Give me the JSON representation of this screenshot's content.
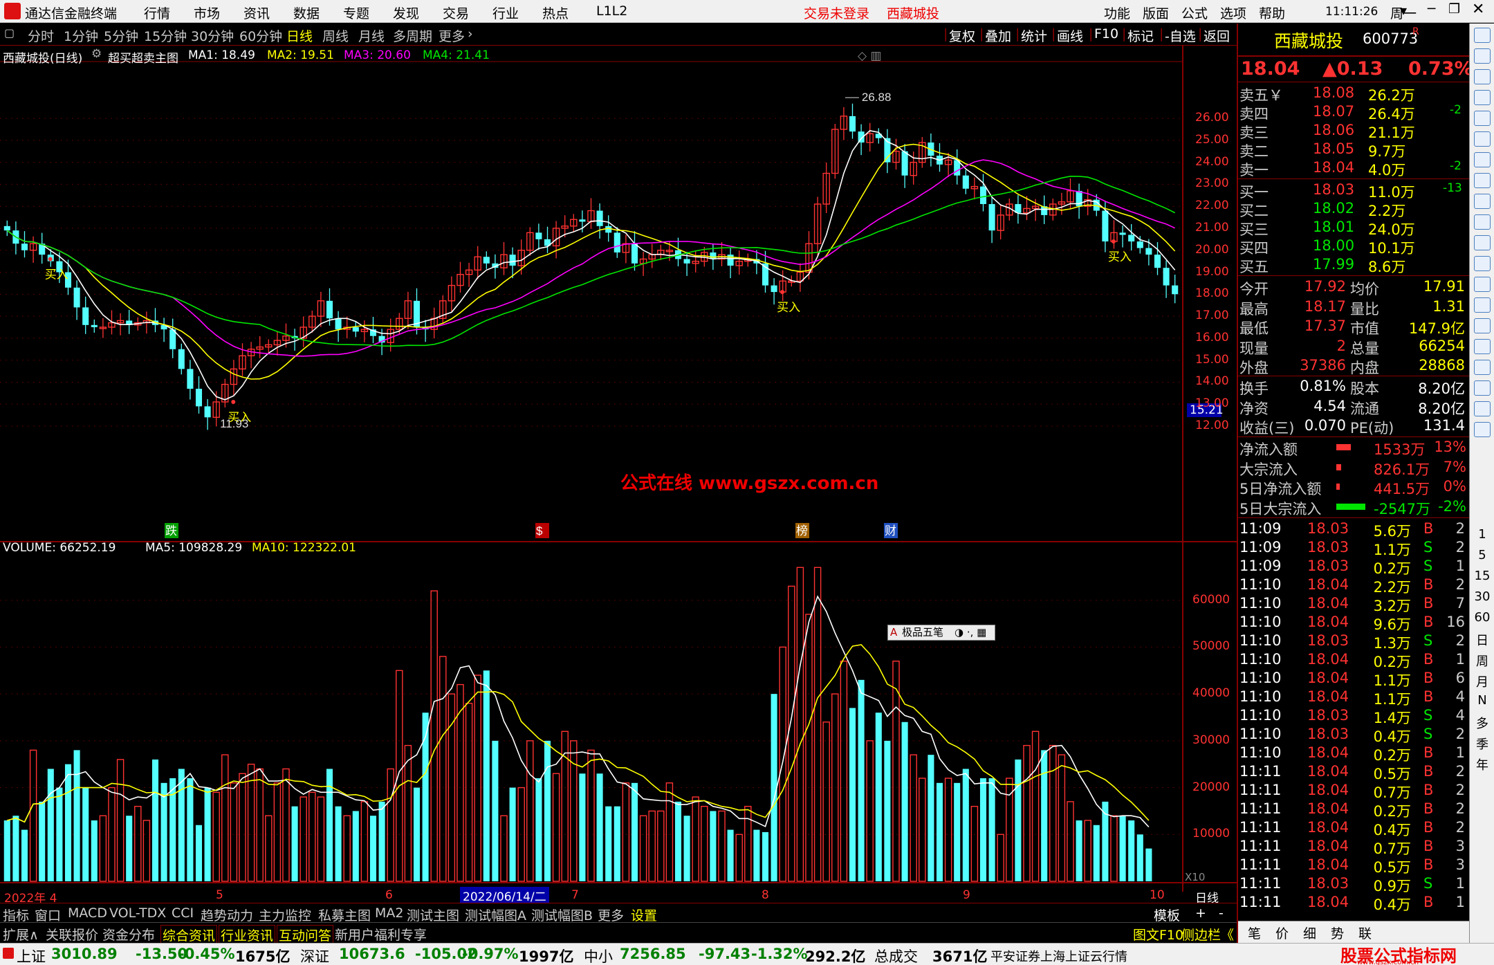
{
  "window": {
    "app_title": "通达信金融终端",
    "menu": [
      "行情",
      "市场",
      "资讯",
      "数据",
      "专题",
      "发现",
      "交易",
      "行业",
      "热点",
      "L1L2"
    ],
    "trade_status": "交易未登录",
    "stock_tab": "西藏城投",
    "right_menu": [
      "功能",
      "版面",
      "公式",
      "选项",
      "帮助"
    ],
    "clock": "11:11:26",
    "weekday": "周一"
  },
  "toolbar": {
    "periods": [
      "分时",
      "1分钟",
      "5分钟",
      "15分钟",
      "30分钟",
      "60分钟",
      "日线",
      "周线",
      "月线",
      "多周期",
      "更多"
    ],
    "active": "日线",
    "right_buttons": [
      "复权",
      "叠加",
      "统计",
      "画线",
      "F10",
      "标记",
      "-自选",
      "返回"
    ]
  },
  "main_chart": {
    "title": "西藏城投(日线)",
    "indicator": "超买超卖主图",
    "ma1": "MA1: 18.49",
    "ma2": "MA2: 19.51",
    "ma3": "MA3: 20.60",
    "ma4": "MA4: 21.41",
    "high_label": "26.88",
    "low_label": "11.93",
    "buy_label": "买入",
    "price_ticks": [
      "26.00",
      "25.00",
      "24.00",
      "23.00",
      "22.00",
      "21.00",
      "20.00",
      "19.00",
      "18.00",
      "17.00",
      "16.00",
      "15.00",
      "14.00",
      "13.00",
      "12.00"
    ],
    "crosshair_price": "15.21",
    "watermark": "公式在线   www.gszx.com.cn",
    "event_markers": [
      "跌",
      "$",
      "榜",
      "财"
    ]
  },
  "volume_chart": {
    "title": "VOLUME: 66252.19",
    "ma5": "MA5: 109828.29",
    "ma10": "MA10: 122322.01",
    "ticks": [
      "60000",
      "50000",
      "40000",
      "30000",
      "20000",
      "10000"
    ],
    "unit": "X10",
    "popup": "极品五笔"
  },
  "time_axis": {
    "labels": [
      "2022年 4",
      "5",
      "6",
      "7",
      "8",
      "9",
      "10"
    ],
    "cursor_date": "2022/06/14/二",
    "right_label": "日线"
  },
  "tabs_row1": {
    "items": [
      "指标",
      "窗口",
      "MACD",
      "VOL-TDX",
      "CCI",
      "趋势动力",
      "主力监控",
      "私募主图",
      "MA2",
      "测试主图",
      "测试幅图A",
      "测试幅图B",
      "更多",
      "设置"
    ],
    "right": [
      "模板",
      "+",
      "-"
    ]
  },
  "tabs_row2": {
    "items": [
      "扩展∧",
      "关联报价",
      "资金分布",
      "综合资讯",
      "行业资讯",
      "互动问答",
      "新用户福利专享"
    ],
    "right": [
      "图文F10",
      "侧边栏《"
    ]
  },
  "quote": {
    "name": "西藏城投",
    "code": "600773",
    "flag": "R",
    "price": "18.04",
    "change": "▲0.13",
    "pct": "0.73%",
    "asks": [
      {
        "label": "卖五￥",
        "price": "18.08",
        "vol": "26.2万",
        "delta": ""
      },
      {
        "label": "卖四",
        "price": "18.07",
        "vol": "26.4万",
        "delta": "-2"
      },
      {
        "label": "卖三",
        "price": "18.06",
        "vol": "21.1万",
        "delta": ""
      },
      {
        "label": "卖二",
        "price": "18.05",
        "vol": "9.7万",
        "delta": ""
      },
      {
        "label": "卖一",
        "price": "18.04",
        "vol": "4.0万",
        "delta": "-2"
      }
    ],
    "bids": [
      {
        "label": "买一",
        "price": "18.03",
        "vol": "11.0万",
        "delta": "-13"
      },
      {
        "label": "买二",
        "price": "18.02",
        "vol": "2.2万",
        "delta": ""
      },
      {
        "label": "买三",
        "price": "18.01",
        "vol": "24.0万",
        "delta": ""
      },
      {
        "label": "买四",
        "price": "18.00",
        "vol": "10.1万",
        "delta": ""
      },
      {
        "label": "买五",
        "price": "17.99",
        "vol": "8.6万",
        "delta": ""
      }
    ],
    "stats1": [
      [
        "今开",
        "17.92",
        "均价",
        "17.91"
      ],
      [
        "最高",
        "18.17",
        "量比",
        "1.31"
      ],
      [
        "最低",
        "17.37",
        "市值",
        "147.9亿"
      ],
      [
        "现量",
        "2",
        "总量",
        "66254"
      ],
      [
        "外盘",
        "37386",
        "内盘",
        "28868"
      ]
    ],
    "stats2": [
      [
        "换手",
        "0.81%",
        "股本",
        "8.20亿"
      ],
      [
        "净资",
        "4.54",
        "流通",
        "8.20亿"
      ],
      [
        "收益(三)",
        "0.070",
        "PE(动)",
        "131.4"
      ]
    ],
    "flows": [
      {
        "label": "净流入额",
        "val": "1533万",
        "pct": "13%",
        "bar": 0.35,
        "color": "#ff3232"
      },
      {
        "label": "大宗流入",
        "val": "826.1万",
        "pct": "7%",
        "bar": 0.12,
        "color": "#ff3232"
      },
      {
        "label": "5日净流入额",
        "val": "441.5万",
        "pct": "0%",
        "bar": 0.08,
        "color": "#ff3232"
      },
      {
        "label": "5日大宗流入",
        "val": "-2547万",
        "pct": "-2%",
        "bar": 0.7,
        "color": "#00e600"
      }
    ],
    "ticks": [
      [
        "11:09",
        "18.03",
        "5.6万",
        "B",
        "2"
      ],
      [
        "11:09",
        "18.03",
        "1.1万",
        "S",
        "2"
      ],
      [
        "11:09",
        "18.03",
        "0.2万",
        "S",
        "1"
      ],
      [
        "11:10",
        "18.04",
        "2.2万",
        "B",
        "2"
      ],
      [
        "11:10",
        "18.04",
        "3.2万",
        "B",
        "7"
      ],
      [
        "11:10",
        "18.04",
        "9.6万",
        "B",
        "16"
      ],
      [
        "11:10",
        "18.03",
        "1.3万",
        "S",
        "2"
      ],
      [
        "11:10",
        "18.04",
        "0.2万",
        "B",
        "1"
      ],
      [
        "11:10",
        "18.04",
        "1.1万",
        "B",
        "6"
      ],
      [
        "11:10",
        "18.04",
        "1.1万",
        "B",
        "4"
      ],
      [
        "11:10",
        "18.03",
        "1.4万",
        "S",
        "4"
      ],
      [
        "11:10",
        "18.03",
        "0.4万",
        "S",
        "2"
      ],
      [
        "11:10",
        "18.04",
        "0.2万",
        "B",
        "1"
      ],
      [
        "11:11",
        "18.04",
        "0.5万",
        "B",
        "2"
      ],
      [
        "11:11",
        "18.04",
        "0.7万",
        "B",
        "2"
      ],
      [
        "11:11",
        "18.04",
        "0.2万",
        "B",
        "2"
      ],
      [
        "11:11",
        "18.04",
        "0.4万",
        "B",
        "2"
      ],
      [
        "11:11",
        "18.04",
        "0.7万",
        "B",
        "3"
      ],
      [
        "11:11",
        "18.04",
        "0.5万",
        "B",
        "3"
      ],
      [
        "11:11",
        "18.03",
        "0.9万",
        "S",
        "1"
      ],
      [
        "11:11",
        "18.04",
        "0.4万",
        "B",
        "1"
      ]
    ],
    "bottom_tabs": [
      "笔",
      "价",
      "细",
      "势",
      "联"
    ]
  },
  "side_strip": {
    "labels": [
      "1",
      "5",
      "15",
      "30",
      "60",
      "日",
      "周",
      "月",
      "N",
      "多",
      "季",
      "年"
    ]
  },
  "status_bar": {
    "items": [
      {
        "name": "上证",
        "value": "3010.89",
        "chg": "-13.50",
        "pct": "-0.45%",
        "amt": "1675亿"
      },
      {
        "name": "深证",
        "value": "10673.6",
        "chg": "-105.02",
        "pct": "-0.97%",
        "amt": "1997亿"
      },
      {
        "name": "中小",
        "value": "7256.85",
        "chg": "-97.43",
        "pct": "-1.32%",
        "amt": "292.2亿"
      }
    ],
    "total_label": "总成交",
    "total": "3671亿",
    "source": "平安证券上海上证云行情",
    "brand": "股票公式指标网",
    "brand_url": "www.gszx.com.cn"
  },
  "chart_data": {
    "type": "candlestick",
    "x_label": "日线",
    "period": "2022-04 to 2022-10",
    "price_range": [
      11.93,
      26.88
    ],
    "closes": [
      20.9,
      20.3,
      20.0,
      20.3,
      19.8,
      19.5,
      19.0,
      18.3,
      17.4,
      16.6,
      16.5,
      16.5,
      16.7,
      16.8,
      16.6,
      16.7,
      16.8,
      16.6,
      16.4,
      15.5,
      14.6,
      13.7,
      12.9,
      12.4,
      13.1,
      13.9,
      14.6,
      15.2,
      15.5,
      15.6,
      15.7,
      15.9,
      16.1,
      16.0,
      16.5,
      17.0,
      17.7,
      16.9,
      16.4,
      16.5,
      16.3,
      16.4,
      16.1,
      15.8,
      16.4,
      16.9,
      17.7,
      16.5,
      16.4,
      16.9,
      17.7,
      18.4,
      18.9,
      19.1,
      19.7,
      19.4,
      19.2,
      19.8,
      19.3,
      20.0,
      20.8,
      20.5,
      20.2,
      21.0,
      21.1,
      21.4,
      21.3,
      21.8,
      21.1,
      20.8,
      19.9,
      20.3,
      19.4,
      19.6,
      19.8,
      20.0,
      20.0,
      19.6,
      19.4,
      19.5,
      19.9,
      19.6,
      19.8,
      19.3,
      19.5,
      19.6,
      19.4,
      18.4,
      18.1,
      18.6,
      18.6,
      19.0,
      20.3,
      22.1,
      23.5,
      25.5,
      26.1,
      25.4,
      24.9,
      25.3,
      25.1,
      24.0,
      24.5,
      23.4,
      24.0,
      24.9,
      24.3,
      23.9,
      24.1,
      23.4,
      22.8,
      22.9,
      22.1,
      20.9,
      21.6,
      22.1,
      21.7,
      21.9,
      22.0,
      21.6,
      22.1,
      22.2,
      22.7,
      22.0,
      22.3,
      21.8,
      20.4,
      20.8,
      20.7,
      20.4,
      20.1,
      19.8,
      19.2,
      18.4,
      18.0
    ],
    "volumes": [
      13000,
      14000,
      11000,
      28000,
      17000,
      24000,
      20000,
      25000,
      28000,
      20000,
      13000,
      14000,
      20000,
      26000,
      14000,
      16000,
      13000,
      26000,
      21000,
      22000,
      24000,
      22000,
      12000,
      20000,
      19000,
      27000,
      21000,
      23000,
      25000,
      24000,
      14000,
      21000,
      24000,
      16000,
      18000,
      19000,
      18000,
      24000,
      16000,
      14000,
      15000,
      17000,
      14000,
      17000,
      24000,
      45000,
      29000,
      20000,
      36000,
      62000,
      48000,
      40000,
      42000,
      38000,
      44000,
      45000,
      30000,
      14000,
      20000,
      20000,
      30000,
      22000,
      30000,
      23000,
      32000,
      30000,
      23000,
      28000,
      23000,
      16000,
      16000,
      21000,
      21000,
      14000,
      15000,
      15000,
      21000,
      17000,
      14000,
      18000,
      16000,
      15000,
      15000,
      11000,
      10000,
      16000,
      11000,
      10500,
      40000,
      50000,
      63000,
      67000,
      57000,
      67000,
      34000,
      40000,
      47000,
      37000,
      43000,
      30000,
      36000,
      30000,
      47000,
      34000,
      27000,
      22000,
      27000,
      21000,
      22000,
      21000,
      24000,
      16000,
      22000,
      22000,
      10000,
      22000,
      26000,
      29000,
      32000,
      28000,
      29000,
      27000,
      17000,
      13000,
      13000,
      12000,
      17000,
      14000,
      14000,
      13000,
      10000,
      7000
    ]
  }
}
